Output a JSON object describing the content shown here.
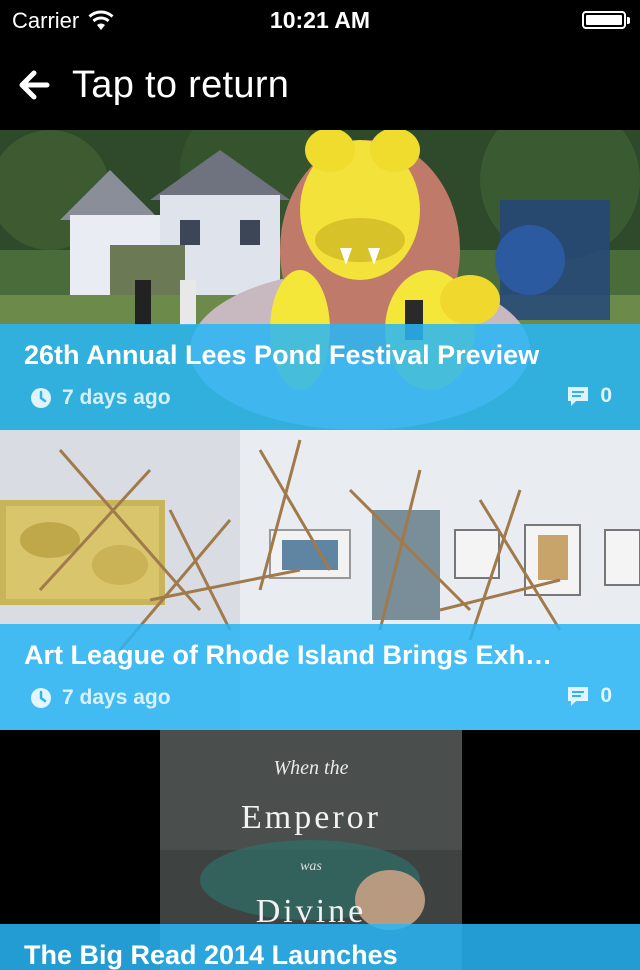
{
  "status_bar": {
    "carrier": "Carrier",
    "time": "10:21 AM"
  },
  "header": {
    "title": "Tap to return",
    "back_icon": "arrow-left-icon"
  },
  "articles": [
    {
      "title": "26th Annual Lees Pond Festival Preview",
      "age": "7 days ago",
      "comments": "0",
      "image": "festival-inflatable-lion-photo"
    },
    {
      "title": "Art League of Rhode Island Brings Exh…",
      "age": "7 days ago",
      "comments": "0",
      "image": "art-gallery-stick-sculpture-photo"
    },
    {
      "title": "The Big Read 2014 Launches",
      "image": "book-cover-photo",
      "book_cover_text": {
        "line1": "When the",
        "line2": "Emperor",
        "line3": "was",
        "line4": "Divine"
      }
    }
  ],
  "colors": {
    "overlay": "#29b6f6",
    "background": "#000000"
  }
}
